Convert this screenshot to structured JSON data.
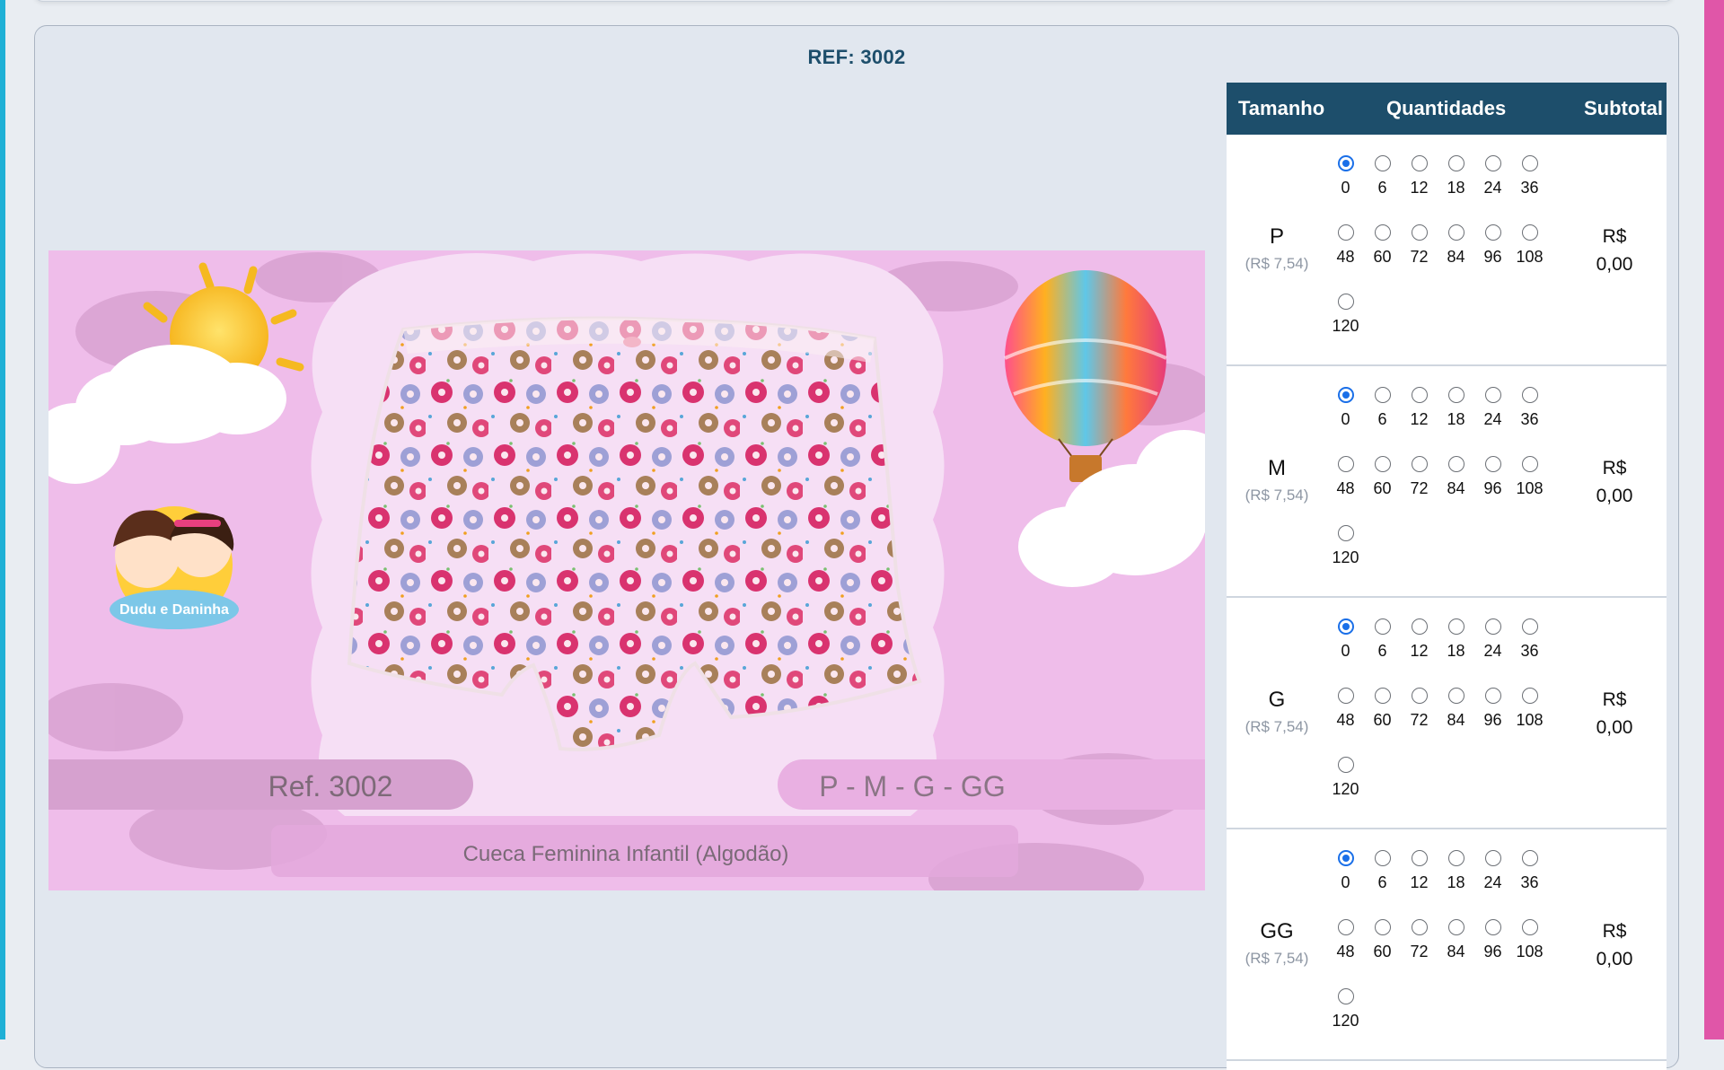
{
  "product": {
    "ref_title": "REF: 3002",
    "image": {
      "ref_label": "Ref. 3002",
      "sizes_label": "P - M - G - GG",
      "description": "Cueca Feminina Infantil (Algodão)",
      "brand_logo_text": "Dudu e Daninha"
    }
  },
  "table": {
    "headers": {
      "size": "Tamanho",
      "quantities": "Quantidades",
      "subtotal": "Subtotal"
    },
    "quantity_options": [
      "0",
      "6",
      "12",
      "18",
      "24",
      "36",
      "48",
      "60",
      "72",
      "84",
      "96",
      "108",
      "120"
    ],
    "rows": [
      {
        "size": "P",
        "price": "(R$ 7,54)",
        "selected_quantity": "0",
        "subtotal_currency": "R$",
        "subtotal_value": "0,00"
      },
      {
        "size": "M",
        "price": "(R$ 7,54)",
        "selected_quantity": "0",
        "subtotal_currency": "R$",
        "subtotal_value": "0,00"
      },
      {
        "size": "G",
        "price": "(R$ 7,54)",
        "selected_quantity": "0",
        "subtotal_currency": "R$",
        "subtotal_value": "0,00"
      },
      {
        "size": "GG",
        "price": "(R$ 7,54)",
        "selected_quantity": "0",
        "subtotal_currency": "R$",
        "subtotal_value": "0,00"
      }
    ]
  },
  "colors": {
    "header_bg": "#1d4e6b",
    "radio_selected": "#1a6fe8",
    "left_edge": "#1fb0d6",
    "right_edge": "#e056a8"
  }
}
